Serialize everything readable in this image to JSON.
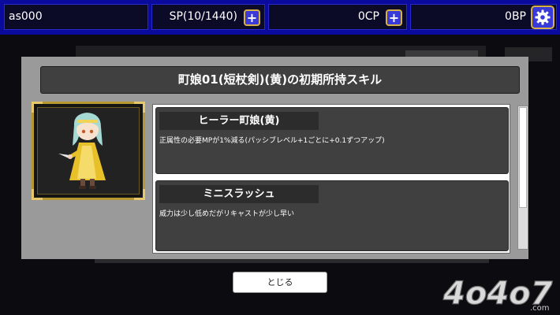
{
  "status_bar": {
    "user_name": "as000",
    "sp": "SP(10/1440)",
    "cp": "0CP",
    "bp": "0BP",
    "plus_glyph": "+"
  },
  "dialog": {
    "title": "町娘01(短杖剣)(黄)の初期所持スキル",
    "skills": [
      {
        "name": "ヒーラー町娘(黄)",
        "description": "正属性の必要MPが1%減る(パッシブレベル+1ごとに+0.1ずつアップ)"
      },
      {
        "name": "ミニスラッシュ",
        "description": "威力は少し低めだがリキャストが少し早い"
      }
    ],
    "close_label": "とじる"
  },
  "watermark": {
    "text": "4o4o7",
    "suffix": ".com"
  },
  "icons": {
    "settings": "gear-icon",
    "add_sp": "plus-icon",
    "add_cp": "plus-icon"
  },
  "colors": {
    "top_bar": "#0a0a9c",
    "modal_bg": "#9a9a9a",
    "panel": "#404040",
    "frame_gold": "#b7972f",
    "character_yellow": "#e8c02a",
    "character_hair": "#a6d8d4"
  }
}
